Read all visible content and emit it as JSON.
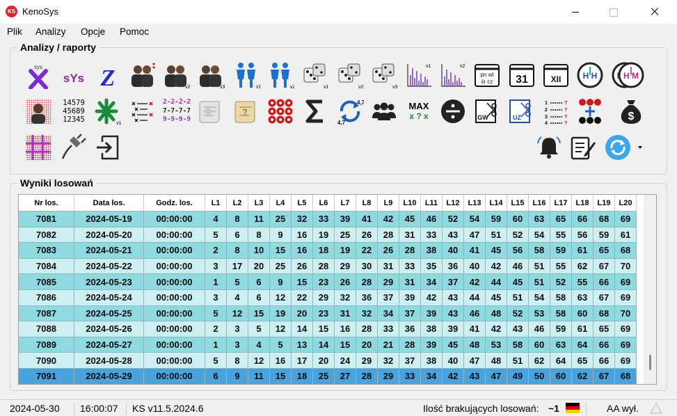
{
  "window": {
    "title": "KenoSys",
    "icon_text": "KS"
  },
  "menu": [
    "Plik",
    "Analizy",
    "Opcje",
    "Pomoc"
  ],
  "toolbar_group_title": "Analizy / raporty",
  "results_group_title": "Wyniki losowań",
  "tool_labels": {
    "sys": "sys",
    "sys_big": "sYs",
    "z": "Z",
    "v1": "v1",
    "v2": "v2",
    "v3": "v3",
    "num1": "14579",
    "num2": "45689",
    "num3": "12345",
    "pattern1": "2-2-2-2",
    "pattern2": "7-7-7-7",
    "pattern3": "9-9-9-9",
    "seq47a": "4,7",
    "seq47b": "4,7",
    "max": "MAX",
    "maxsub": "x ? x",
    "cal_top": "pn wt",
    "cal_bot": "śr cz",
    "cal31": "31",
    "calXII": "XII",
    "hh": "H H",
    "mm": "M M",
    "hm": "H M",
    "gw": "GW",
    "uz": "UZ"
  },
  "grid": {
    "headers": [
      "Nr los.",
      "Data los.",
      "Godz. los.",
      "L1",
      "L2",
      "L3",
      "L4",
      "L5",
      "L6",
      "L7",
      "L8",
      "L9",
      "L10",
      "L11",
      "L12",
      "L13",
      "L14",
      "L15",
      "L16",
      "L17",
      "L18",
      "L19",
      "L20"
    ],
    "rows": [
      [
        "7081",
        "2024-05-19",
        "00:00:00",
        "4",
        "8",
        "11",
        "25",
        "32",
        "33",
        "39",
        "41",
        "42",
        "45",
        "46",
        "52",
        "54",
        "59",
        "60",
        "63",
        "65",
        "66",
        "68",
        "69"
      ],
      [
        "7082",
        "2024-05-20",
        "00:00:00",
        "5",
        "6",
        "8",
        "9",
        "16",
        "19",
        "25",
        "26",
        "28",
        "31",
        "33",
        "43",
        "47",
        "51",
        "52",
        "54",
        "55",
        "56",
        "59",
        "61"
      ],
      [
        "7083",
        "2024-05-21",
        "00:00:00",
        "2",
        "8",
        "10",
        "15",
        "16",
        "18",
        "19",
        "22",
        "26",
        "28",
        "38",
        "40",
        "41",
        "45",
        "56",
        "58",
        "59",
        "61",
        "65",
        "68"
      ],
      [
        "7084",
        "2024-05-22",
        "00:00:00",
        "3",
        "17",
        "20",
        "25",
        "26",
        "28",
        "29",
        "30",
        "31",
        "33",
        "35",
        "36",
        "40",
        "42",
        "46",
        "51",
        "55",
        "62",
        "67",
        "70"
      ],
      [
        "7085",
        "2024-05-23",
        "00:00:00",
        "1",
        "5",
        "6",
        "9",
        "15",
        "23",
        "26",
        "28",
        "29",
        "31",
        "34",
        "37",
        "42",
        "44",
        "45",
        "51",
        "52",
        "55",
        "66",
        "69"
      ],
      [
        "7086",
        "2024-05-24",
        "00:00:00",
        "3",
        "4",
        "6",
        "12",
        "22",
        "29",
        "32",
        "36",
        "37",
        "39",
        "42",
        "43",
        "44",
        "45",
        "51",
        "54",
        "58",
        "63",
        "67",
        "69"
      ],
      [
        "7087",
        "2024-05-25",
        "00:00:00",
        "5",
        "12",
        "15",
        "19",
        "20",
        "23",
        "31",
        "32",
        "34",
        "37",
        "39",
        "43",
        "46",
        "48",
        "52",
        "53",
        "58",
        "60",
        "68",
        "70"
      ],
      [
        "7088",
        "2024-05-26",
        "00:00:00",
        "2",
        "3",
        "5",
        "12",
        "14",
        "15",
        "16",
        "28",
        "33",
        "36",
        "38",
        "39",
        "41",
        "42",
        "43",
        "46",
        "59",
        "61",
        "65",
        "69"
      ],
      [
        "7089",
        "2024-05-27",
        "00:00:00",
        "1",
        "3",
        "4",
        "5",
        "13",
        "14",
        "15",
        "20",
        "21",
        "28",
        "39",
        "45",
        "48",
        "53",
        "58",
        "60",
        "63",
        "64",
        "66",
        "69"
      ],
      [
        "7090",
        "2024-05-28",
        "00:00:00",
        "5",
        "8",
        "12",
        "16",
        "17",
        "20",
        "24",
        "29",
        "32",
        "37",
        "38",
        "40",
        "47",
        "48",
        "51",
        "62",
        "64",
        "65",
        "66",
        "69"
      ],
      [
        "7091",
        "2024-05-29",
        "00:00:00",
        "6",
        "9",
        "11",
        "15",
        "18",
        "25",
        "27",
        "28",
        "29",
        "33",
        "34",
        "42",
        "43",
        "47",
        "49",
        "50",
        "60",
        "62",
        "67",
        "68"
      ]
    ],
    "selected_row": 10
  },
  "status": {
    "date": "2024-05-30",
    "time": "16:00:07",
    "version": "KS v11.5.2024.6",
    "missing_label": "Ilość brakujących losowań:",
    "missing_value": "~1",
    "aa": "AA wył."
  }
}
